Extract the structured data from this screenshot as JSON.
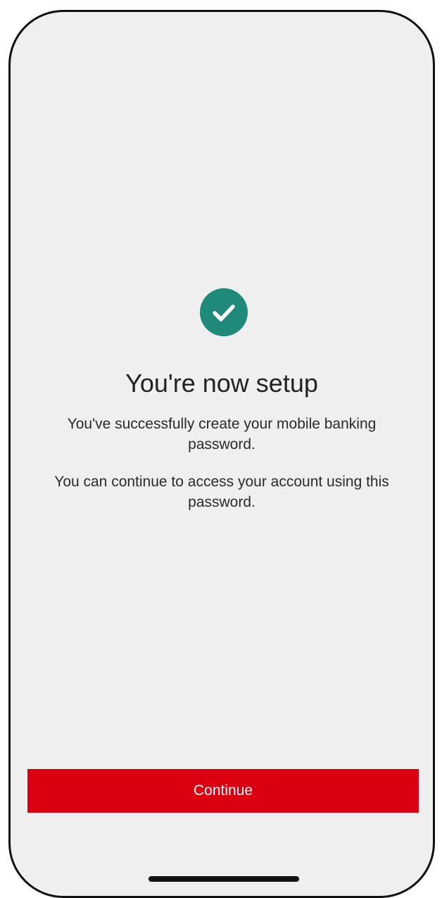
{
  "screen": {
    "title": "You're now setup",
    "message_line1": "You've successfully create your mobile banking password.",
    "message_line2": "You can continue to access your account using this password.",
    "icon": "checkmark-circle-icon",
    "icon_color": "#1f8a79"
  },
  "actions": {
    "continue_label": "Continue",
    "continue_color": "#db0011"
  },
  "theme": {
    "background": "#efefef",
    "text": "#222222"
  }
}
